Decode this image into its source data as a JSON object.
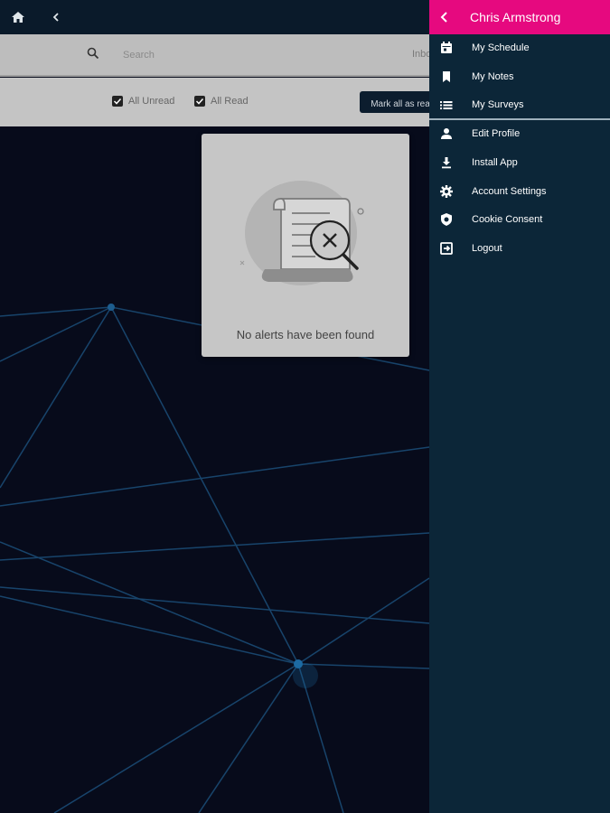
{
  "colors": {
    "accent": "#e6097f",
    "drawer_bg": "#0c2638",
    "topbar_bg": "#0a1a2a",
    "page_bg": "#070b1b"
  },
  "topbar": {
    "home_icon": "home-icon",
    "back_icon": "chevron-left-icon"
  },
  "search": {
    "placeholder": "Search",
    "value": ""
  },
  "tabs": {
    "inbox_label": "Inbo"
  },
  "filters": {
    "unread_label": "All Unread",
    "read_label": "All Read",
    "unread_checked": true,
    "read_checked": true
  },
  "actions": {
    "mark_all_label": "Mark all as rea"
  },
  "empty_state": {
    "message": "No alerts have been found"
  },
  "drawer": {
    "user_name": "Chris Armstrong",
    "items": [
      {
        "label": "My Schedule",
        "icon": "calendar-icon"
      },
      {
        "label": "My Notes",
        "icon": "bookmark-icon"
      },
      {
        "label": "My Surveys",
        "icon": "list-icon"
      },
      {
        "label": "Edit Profile",
        "icon": "person-icon"
      },
      {
        "label": "Install App",
        "icon": "download-icon"
      },
      {
        "label": "Account Settings",
        "icon": "gear-icon"
      },
      {
        "label": "Cookie Consent",
        "icon": "shield-icon"
      },
      {
        "label": "Logout",
        "icon": "logout-icon"
      }
    ]
  }
}
